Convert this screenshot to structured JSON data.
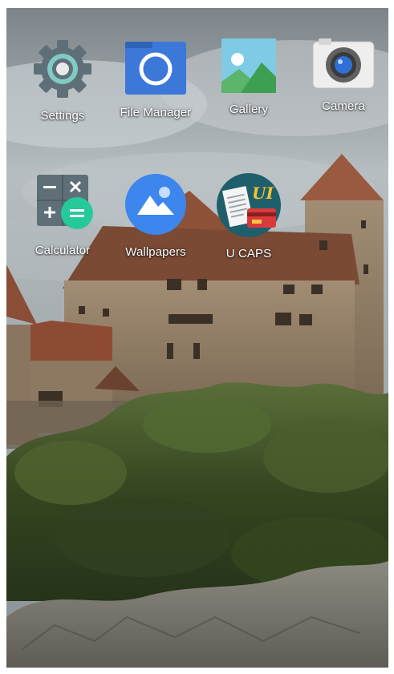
{
  "home_screen": {
    "apps": [
      {
        "label": "Settings",
        "icon": "gear-icon"
      },
      {
        "label": "File Manager",
        "icon": "file-manager-icon"
      },
      {
        "label": "Gallery",
        "icon": "gallery-icon"
      },
      {
        "label": "Camera",
        "icon": "camera-icon"
      },
      {
        "label": "Calculator",
        "icon": "calculator-icon"
      },
      {
        "label": "Wallpapers",
        "icon": "wallpapers-icon"
      },
      {
        "label": "U CAPS",
        "icon": "ucaps-icon"
      }
    ]
  },
  "colors": {
    "settings_teal": "#80cbc4",
    "file_manager_blue": "#3b78d8",
    "gallery_green": "#5bb56a",
    "calculator_green": "#26c99a",
    "wallpapers_blue": "#3d86ee",
    "ucaps_teal": "#1e5f6b"
  }
}
